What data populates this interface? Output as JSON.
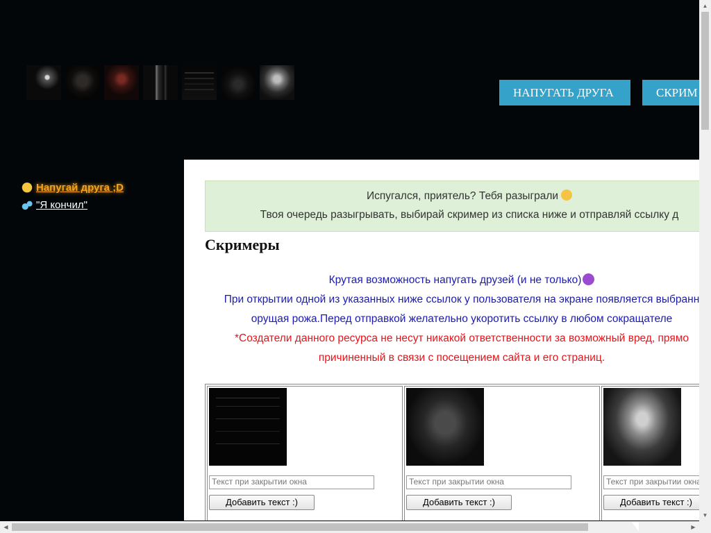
{
  "header": {
    "thumbnails": [
      "scary-face-1",
      "scary-face-2",
      "scary-face-3",
      "scary-face-4",
      "scary-face-5",
      "scary-face-6",
      "scary-face-7"
    ],
    "buttons": [
      {
        "label": "НАПУГАТЬ ДРУГА"
      },
      {
        "label": "СКРИМ"
      }
    ]
  },
  "sidebar": {
    "items": [
      {
        "icon": "screaming-emoji-icon",
        "label": "Напугай друга ;D"
      },
      {
        "icon": "sweat-drops-emoji-icon",
        "label": "\"Я кончил\""
      }
    ]
  },
  "alert": {
    "line1": "Испугался, приятель? Тебя разыграли",
    "line2": "Твоя очередь разыгрывать, выбирай скример из списка ниже и отправляй ссылку д"
  },
  "main": {
    "title": "Скримеры",
    "desc1": "Крутая возможность напугать друзей (и не только)",
    "desc2": "При открытии одной из указанных ниже ссылок у пользователя на экране появляется выбранн",
    "desc3": "орущая рожа.Перед отправкой желательно укоротить ссылку в любом сокращателе",
    "warn1": "*Создатели данного ресурса не несут никакой ответственности за возможный вред, прямо",
    "warn2": "причиненный в связи с посещением сайта и его страниц."
  },
  "screamers": [
    {
      "placeholder": "Текст при закрытии окна",
      "button": "Добавить текст :)"
    },
    {
      "placeholder": "Текст при закрытии окна",
      "button": "Добавить текст :)"
    },
    {
      "placeholder": "Текст при закрытии окна",
      "button": "Добавить текст :)"
    }
  ]
}
